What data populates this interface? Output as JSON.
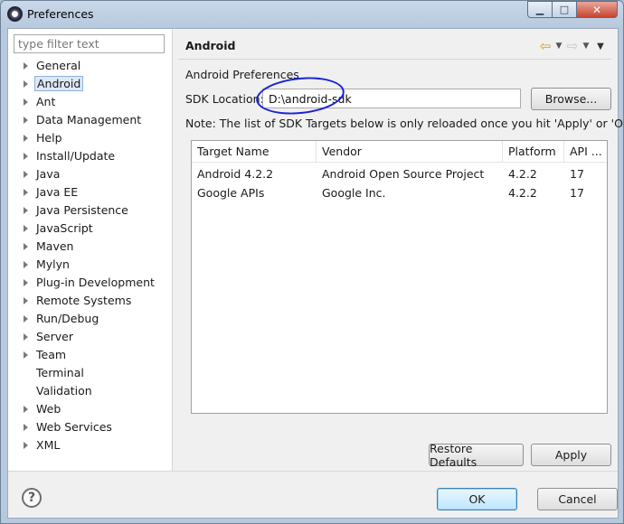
{
  "window": {
    "title": "Preferences",
    "minimize_label": "▁",
    "maximize_label": "□",
    "close_label": "✕"
  },
  "filter": {
    "placeholder": "type filter text"
  },
  "tree": {
    "items": [
      {
        "label": "General",
        "expandable": true
      },
      {
        "label": "Android",
        "expandable": true,
        "selected": true
      },
      {
        "label": "Ant",
        "expandable": true
      },
      {
        "label": "Data Management",
        "expandable": true
      },
      {
        "label": "Help",
        "expandable": true
      },
      {
        "label": "Install/Update",
        "expandable": true
      },
      {
        "label": "Java",
        "expandable": true
      },
      {
        "label": "Java EE",
        "expandable": true
      },
      {
        "label": "Java Persistence",
        "expandable": true
      },
      {
        "label": "JavaScript",
        "expandable": true
      },
      {
        "label": "Maven",
        "expandable": true
      },
      {
        "label": "Mylyn",
        "expandable": true
      },
      {
        "label": "Plug-in Development",
        "expandable": true
      },
      {
        "label": "Remote Systems",
        "expandable": true
      },
      {
        "label": "Run/Debug",
        "expandable": true
      },
      {
        "label": "Server",
        "expandable": true
      },
      {
        "label": "Team",
        "expandable": true
      },
      {
        "label": "Terminal",
        "expandable": false
      },
      {
        "label": "Validation",
        "expandable": false
      },
      {
        "label": "Web",
        "expandable": true
      },
      {
        "label": "Web Services",
        "expandable": true
      },
      {
        "label": "XML",
        "expandable": true
      }
    ]
  },
  "page": {
    "title": "Android",
    "section_label": "Android Preferences",
    "sdk_label": "SDK Location:",
    "sdk_value": "D:\\android-sdk",
    "browse_label": "Browse...",
    "note": "Note: The list of SDK Targets below is only reloaded once you hit 'Apply' or 'OK'.",
    "restore_label": "Restore Defaults",
    "apply_label": "Apply"
  },
  "table": {
    "columns": [
      "Target Name",
      "Vendor",
      "Platform",
      "API ..."
    ],
    "rows": [
      [
        "Android 4.2.2",
        "Android Open Source Project",
        "4.2.2",
        "17"
      ],
      [
        "Google APIs",
        "Google Inc.",
        "4.2.2",
        "17"
      ]
    ]
  },
  "footer": {
    "help_label": "?",
    "ok_label": "OK",
    "cancel_label": "Cancel"
  },
  "colors": {
    "annotation_circle": "#1a22d6",
    "ok_border": "#3c7fb1",
    "selection": "#dde8f5"
  }
}
